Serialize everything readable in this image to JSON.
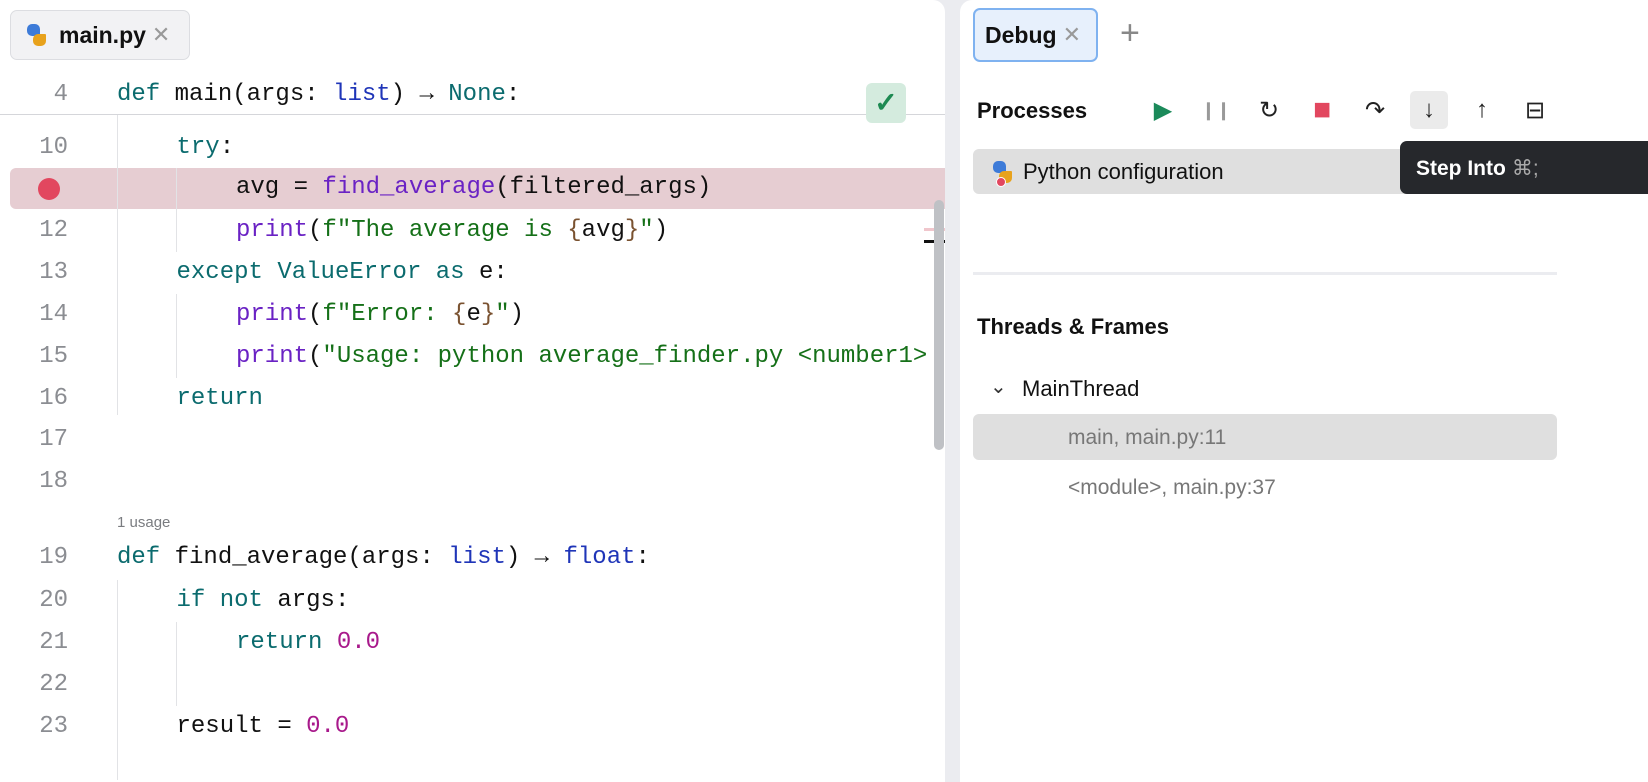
{
  "editor": {
    "tab": {
      "label": "main.py"
    },
    "usage_hint": "1 usage",
    "lines": [
      {
        "n": "4",
        "indent": 0,
        "tokens": [
          [
            "def ",
            "k"
          ],
          [
            "main",
            "t"
          ],
          [
            "(args: ",
            "t"
          ],
          [
            "list",
            "b"
          ],
          [
            ") → ",
            "t"
          ],
          [
            "None",
            "k"
          ],
          [
            ":",
            "t"
          ]
        ]
      },
      {
        "n": "10",
        "indent": 1,
        "tokens": [
          [
            "try",
            "k"
          ],
          [
            ":",
            "t"
          ]
        ]
      },
      {
        "n": "",
        "indent": 2,
        "tokens": [
          [
            "avg = ",
            "t"
          ],
          [
            "find_average",
            "f"
          ],
          [
            "(filtered_args)",
            "t"
          ]
        ]
      },
      {
        "n": "12",
        "indent": 2,
        "tokens": [
          [
            "print",
            "f"
          ],
          [
            "(",
            "t"
          ],
          [
            "f\"The average is ",
            "s"
          ],
          [
            "{",
            "br"
          ],
          [
            "avg",
            "t"
          ],
          [
            "}",
            "br"
          ],
          [
            "\"",
            "s"
          ],
          [
            ")",
            "t"
          ]
        ]
      },
      {
        "n": "13",
        "indent": 1,
        "tokens": [
          [
            "except ",
            "k"
          ],
          [
            "ValueError ",
            "k"
          ],
          [
            "as ",
            "k"
          ],
          [
            "e:",
            "t"
          ]
        ]
      },
      {
        "n": "14",
        "indent": 2,
        "tokens": [
          [
            "print",
            "f"
          ],
          [
            "(",
            "t"
          ],
          [
            "f\"Error: ",
            "s"
          ],
          [
            "{",
            "br"
          ],
          [
            "e",
            "t"
          ],
          [
            "}",
            "br"
          ],
          [
            "\"",
            "s"
          ],
          [
            ")",
            "t"
          ]
        ]
      },
      {
        "n": "15",
        "indent": 2,
        "tokens": [
          [
            "print",
            "f"
          ],
          [
            "(",
            "t"
          ],
          [
            "\"Usage: python average_finder.py <number1>",
            "s"
          ]
        ]
      },
      {
        "n": "16",
        "indent": 1,
        "tokens": [
          [
            "return",
            "k"
          ]
        ]
      },
      {
        "n": "17",
        "indent": 0,
        "tokens": []
      },
      {
        "n": "18",
        "indent": 0,
        "tokens": []
      },
      {
        "n": "19",
        "indent": 0,
        "tokens": [
          [
            "def ",
            "k"
          ],
          [
            "find_average",
            "t"
          ],
          [
            "(args: ",
            "t"
          ],
          [
            "list",
            "b"
          ],
          [
            ") → ",
            "t"
          ],
          [
            "float",
            "b"
          ],
          [
            ":",
            "t"
          ]
        ]
      },
      {
        "n": "20",
        "indent": 1,
        "tokens": [
          [
            "if not ",
            "k"
          ],
          [
            "args:",
            "t"
          ]
        ]
      },
      {
        "n": "21",
        "indent": 2,
        "tokens": [
          [
            "return ",
            "k"
          ],
          [
            "0.0",
            "n"
          ]
        ]
      },
      {
        "n": "22",
        "indent": 0,
        "tokens": []
      },
      {
        "n": "23",
        "indent": 1,
        "tokens": [
          [
            "result = ",
            "t"
          ],
          [
            "0.0",
            "n"
          ]
        ]
      }
    ]
  },
  "debug": {
    "tab": {
      "label": "Debug"
    },
    "processes_title": "Processes",
    "toolbar": {
      "resume": "▶",
      "pause": "❙❙",
      "rerun": "↻",
      "stop": "■",
      "step_over": "↷",
      "step_into": "↓",
      "step_out": "↑",
      "console": "⊟"
    },
    "process": {
      "label": "Python configuration"
    },
    "tooltip": {
      "label": "Step Into",
      "shortcut": "⌘;"
    },
    "threads_title": "Threads & Frames",
    "thread": {
      "label": "MainThread"
    },
    "frames": [
      {
        "label": "main, main.py:11"
      },
      {
        "label": "<module>, main.py:37"
      }
    ],
    "colors": {
      "accent": "#7fb2f0",
      "stop": "#e2475f",
      "resume": "#1b8a5a"
    }
  }
}
